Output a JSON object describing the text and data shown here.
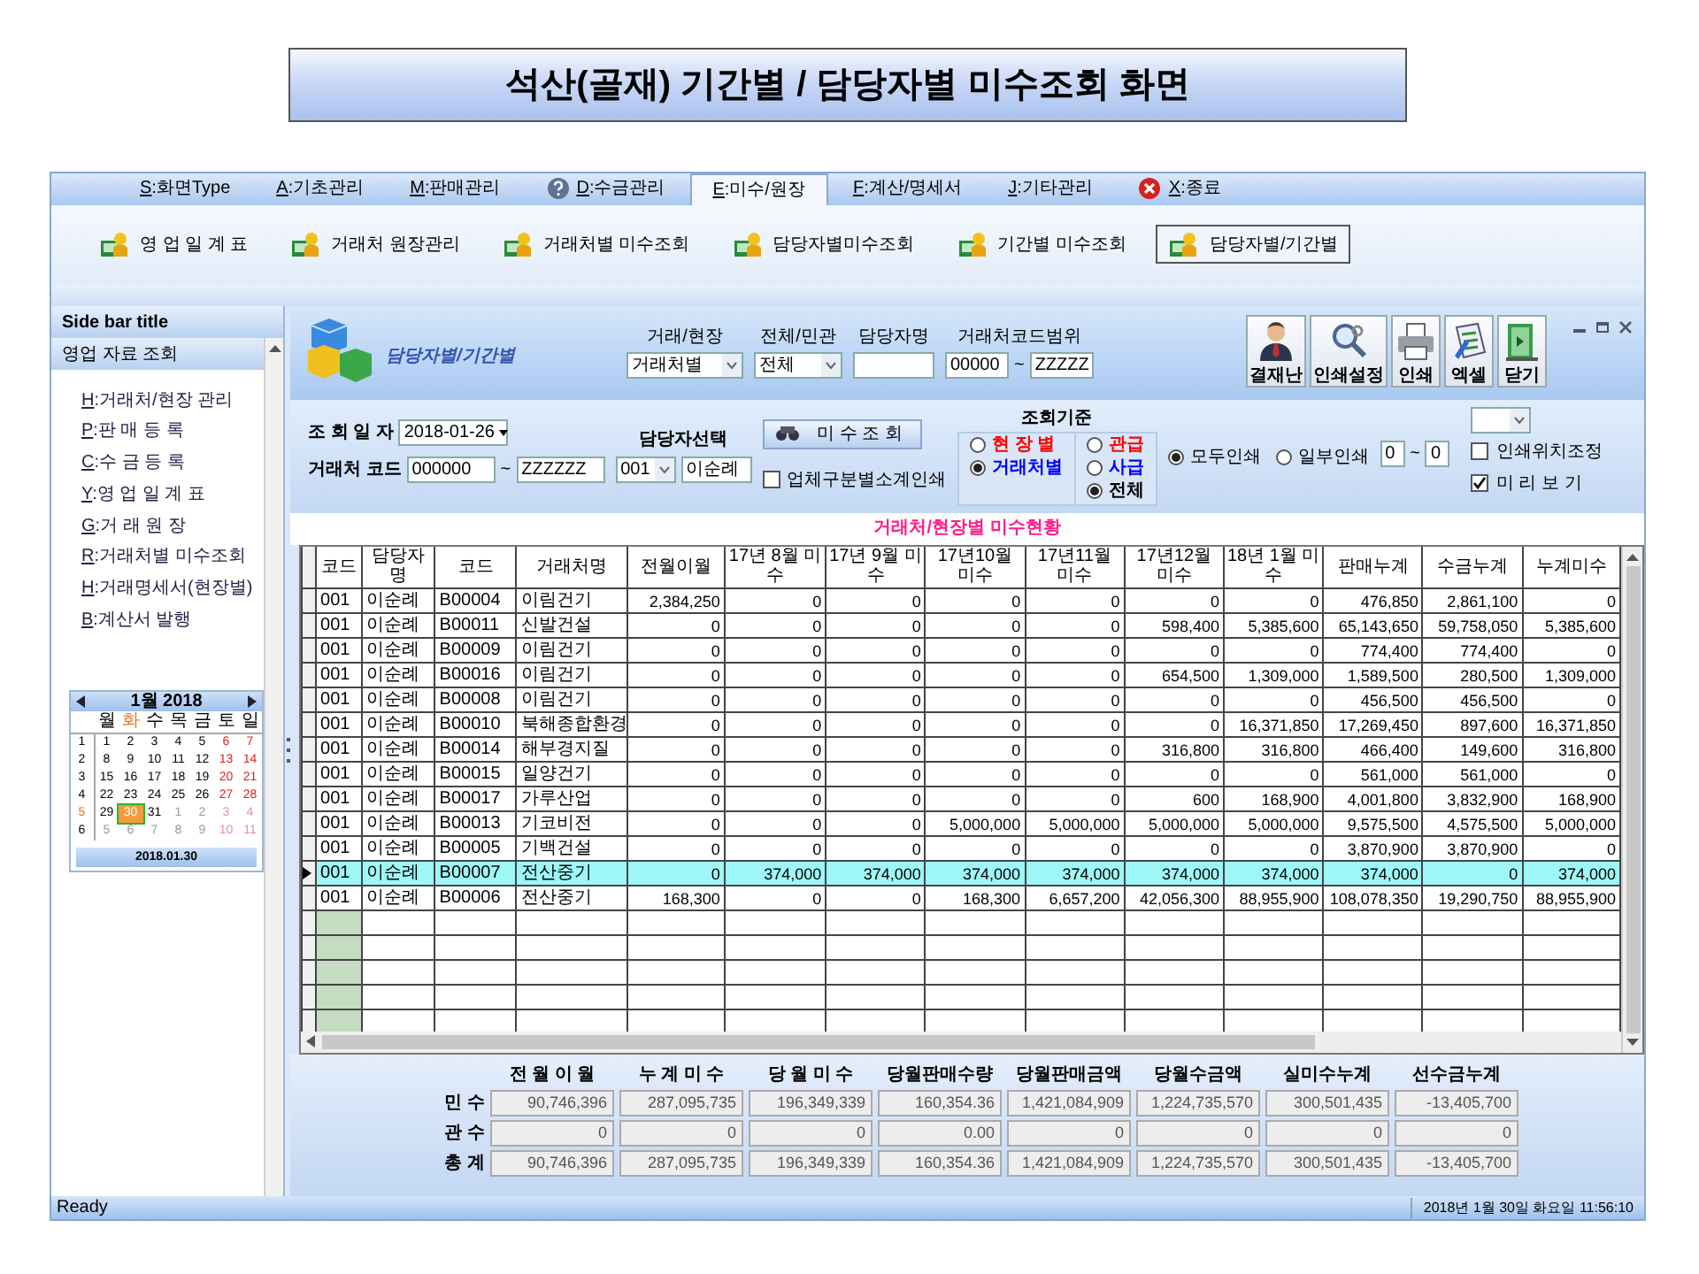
{
  "page_title": "석산(골재) 기간별 / 담당자별 미수조회 화면",
  "menu": [
    {
      "label": "S:화면Type",
      "kind": "plain",
      "selected": false
    },
    {
      "label": "A:기초관리",
      "kind": "plain",
      "selected": false
    },
    {
      "label": "M:판매관리",
      "kind": "plain",
      "selected": false
    },
    {
      "label": "D:수금관리",
      "kind": "help",
      "selected": false
    },
    {
      "label": "E:미수/원장",
      "kind": "plain",
      "selected": true
    },
    {
      "label": "F:계산/명세서",
      "kind": "plain",
      "selected": false
    },
    {
      "label": "J:기타관리",
      "kind": "plain",
      "selected": false
    },
    {
      "label": "X:종료",
      "kind": "exit",
      "selected": false
    }
  ],
  "ribbon": [
    {
      "label": "영 업 일 계 표",
      "selected": false
    },
    {
      "label": "거래처 원장관리",
      "selected": false
    },
    {
      "label": "거래처별 미수조회",
      "selected": false
    },
    {
      "label": "담당자별미수조회",
      "selected": false
    },
    {
      "label": "기간별 미수조회",
      "selected": false
    },
    {
      "label": "담당자별/기간별",
      "selected": true
    }
  ],
  "sidebar": {
    "title": "Side bar title",
    "group": "영업 자료 조회",
    "items": [
      "H:거래처/현장 관리",
      "P:판 매 등 록",
      "C:수 금 등 록",
      "Y:영 업 일 계 표",
      "G:거 래 원 장",
      "R:거래처별 미수조회",
      "H:거래명세서(현장별)",
      "B:계산서 발행"
    ],
    "calendar": {
      "month": "1월 2018",
      "weekdays": [
        {
          "label": "월",
          "current": false
        },
        {
          "label": "화",
          "current": true
        },
        {
          "label": "수",
          "current": false
        },
        {
          "label": "목",
          "current": false
        },
        {
          "label": "금",
          "current": false
        },
        {
          "label": "토",
          "current": false
        },
        {
          "label": "일",
          "current": false
        }
      ],
      "weeks": [
        {
          "number": "1",
          "current": false,
          "days": [
            {
              "day": "1",
              "weekend": false,
              "other": false,
              "selected": false
            },
            {
              "day": "2",
              "weekend": false,
              "other": false,
              "selected": false
            },
            {
              "day": "3",
              "weekend": false,
              "other": false,
              "selected": false
            },
            {
              "day": "4",
              "weekend": false,
              "other": false,
              "selected": false
            },
            {
              "day": "5",
              "weekend": false,
              "other": false,
              "selected": false
            },
            {
              "day": "6",
              "weekend": true,
              "other": false,
              "selected": false
            },
            {
              "day": "7",
              "weekend": true,
              "other": false,
              "selected": false
            }
          ]
        },
        {
          "number": "2",
          "current": false,
          "days": [
            {
              "day": "8",
              "weekend": false,
              "other": false,
              "selected": false
            },
            {
              "day": "9",
              "weekend": false,
              "other": false,
              "selected": false
            },
            {
              "day": "10",
              "weekend": false,
              "other": false,
              "selected": false
            },
            {
              "day": "11",
              "weekend": false,
              "other": false,
              "selected": false
            },
            {
              "day": "12",
              "weekend": false,
              "other": false,
              "selected": false
            },
            {
              "day": "13",
              "weekend": true,
              "other": false,
              "selected": false
            },
            {
              "day": "14",
              "weekend": true,
              "other": false,
              "selected": false
            }
          ]
        },
        {
          "number": "3",
          "current": false,
          "days": [
            {
              "day": "15",
              "weekend": false,
              "other": false,
              "selected": false
            },
            {
              "day": "16",
              "weekend": false,
              "other": false,
              "selected": false
            },
            {
              "day": "17",
              "weekend": false,
              "other": false,
              "selected": false
            },
            {
              "day": "18",
              "weekend": false,
              "other": false,
              "selected": false
            },
            {
              "day": "19",
              "weekend": false,
              "other": false,
              "selected": false
            },
            {
              "day": "20",
              "weekend": true,
              "other": false,
              "selected": false
            },
            {
              "day": "21",
              "weekend": true,
              "other": false,
              "selected": false
            }
          ]
        },
        {
          "number": "4",
          "current": false,
          "days": [
            {
              "day": "22",
              "weekend": false,
              "other": false,
              "selected": false
            },
            {
              "day": "23",
              "weekend": false,
              "other": false,
              "selected": false
            },
            {
              "day": "24",
              "weekend": false,
              "other": false,
              "selected": false
            },
            {
              "day": "25",
              "weekend": false,
              "other": false,
              "selected": false
            },
            {
              "day": "26",
              "weekend": false,
              "other": false,
              "selected": false
            },
            {
              "day": "27",
              "weekend": true,
              "other": false,
              "selected": false
            },
            {
              "day": "28",
              "weekend": true,
              "other": false,
              "selected": false
            }
          ]
        },
        {
          "number": "5",
          "current": true,
          "days": [
            {
              "day": "29",
              "weekend": false,
              "other": false,
              "selected": false
            },
            {
              "day": "30",
              "weekend": false,
              "other": false,
              "selected": true
            },
            {
              "day": "31",
              "weekend": false,
              "other": false,
              "selected": false
            },
            {
              "day": "1",
              "weekend": false,
              "other": true,
              "selected": false
            },
            {
              "day": "2",
              "weekend": false,
              "other": true,
              "selected": false
            },
            {
              "day": "3",
              "weekend": true,
              "other": true,
              "selected": false
            },
            {
              "day": "4",
              "weekend": true,
              "other": true,
              "selected": false
            }
          ]
        },
        {
          "number": "6",
          "current": false,
          "days": [
            {
              "day": "5",
              "weekend": false,
              "other": true,
              "selected": false
            },
            {
              "day": "6",
              "weekend": false,
              "other": true,
              "selected": false
            },
            {
              "day": "7",
              "weekend": false,
              "other": true,
              "selected": false
            },
            {
              "day": "8",
              "weekend": false,
              "other": true,
              "selected": false
            },
            {
              "day": "9",
              "weekend": false,
              "other": true,
              "selected": false
            },
            {
              "day": "10",
              "weekend": true,
              "other": true,
              "selected": false
            },
            {
              "day": "11",
              "weekend": true,
              "other": true,
              "selected": false
            }
          ]
        }
      ],
      "footer": "2018.01.30"
    }
  },
  "form": {
    "title": "담당자별/기간별",
    "filters": [
      {
        "label": "거래/현장",
        "kind": "combo",
        "value": "거래처별"
      },
      {
        "label": "전체/민관",
        "kind": "combo",
        "value": "전체"
      },
      {
        "label": "담당자명",
        "kind": "text"
      },
      {
        "label": "거래처코드범위",
        "kind": "range",
        "from": "00000",
        "separator": "~",
        "to": "ZZZZZ"
      }
    ],
    "actions": [
      {
        "label": "결재난",
        "kind": "person"
      },
      {
        "label": "인쇄설정",
        "kind": "magnifier"
      },
      {
        "label": "인쇄",
        "kind": "printer"
      },
      {
        "label": "엑셀",
        "kind": "sheet"
      },
      {
        "label": "닫기",
        "kind": "exit"
      }
    ]
  },
  "query": {
    "date_label": "조 회 일 자",
    "date": "2018-01-26",
    "code_label": "거래처 코드",
    "code_from": "000000",
    "code_separator": "~",
    "code_to": "ZZZZZZ",
    "manager_label": "담당자선택",
    "manager_code": "001",
    "manager_name": "이순례",
    "search_button": "미 수 조 회",
    "subtotal": {
      "label": "업체구분별소계인쇄",
      "checked": false
    },
    "criteria": {
      "title": "조회기준",
      "groups": [
        {
          "options": [
            {
              "label": "현 장 별",
              "color": "#ff0000",
              "selected": false
            },
            {
              "label": "거래처별",
              "color": "#0000ff",
              "selected": true
            }
          ]
        },
        {
          "options": [
            {
              "label": "관급",
              "color": "#ff0000",
              "selected": false
            },
            {
              "label": "사급",
              "color": "#0000ff",
              "selected": false
            },
            {
              "label": "전체",
              "color": "#000000",
              "selected": true
            }
          ]
        }
      ]
    },
    "print_mode": [
      {
        "label": "모두인쇄",
        "selected": true
      },
      {
        "label": "일부인쇄",
        "selected": false
      }
    ],
    "pages_from": "0",
    "pages_separator": "~",
    "pages_to": "0",
    "options": [
      {
        "label": "인쇄위치조정",
        "checked": false
      },
      {
        "label": "미 리 보 기",
        "checked": true
      }
    ]
  },
  "table": {
    "title": "거래처/현장별 미수현황",
    "columns": [
      "코드",
      "담당자명",
      "코드",
      "거래처명",
      "전월이월",
      "17년 8월 미수",
      "17년 9월 미수",
      "17년10월 미수",
      "17년11월 미수",
      "17년12월 미수",
      "18년 1월 미수",
      "판매누계",
      "수금누계",
      "누계미수"
    ],
    "rows": [
      {
        "selected": false,
        "cells": [
          "001",
          "이순례",
          "B00004",
          "이림건기",
          "2,384,250",
          "0",
          "0",
          "0",
          "0",
          "0",
          "0",
          "476,850",
          "2,861,100",
          "0"
        ]
      },
      {
        "selected": false,
        "cells": [
          "001",
          "이순례",
          "B00011",
          "신발건설",
          "0",
          "0",
          "0",
          "0",
          "0",
          "598,400",
          "5,385,600",
          "65,143,650",
          "59,758,050",
          "5,385,600"
        ]
      },
      {
        "selected": false,
        "cells": [
          "001",
          "이순례",
          "B00009",
          "이림건기",
          "0",
          "0",
          "0",
          "0",
          "0",
          "0",
          "0",
          "774,400",
          "774,400",
          "0"
        ]
      },
      {
        "selected": false,
        "cells": [
          "001",
          "이순례",
          "B00016",
          "이림건기",
          "0",
          "0",
          "0",
          "0",
          "0",
          "654,500",
          "1,309,000",
          "1,589,500",
          "280,500",
          "1,309,000"
        ]
      },
      {
        "selected": false,
        "cells": [
          "001",
          "이순례",
          "B00008",
          "이림건기",
          "0",
          "0",
          "0",
          "0",
          "0",
          "0",
          "0",
          "456,500",
          "456,500",
          "0"
        ]
      },
      {
        "selected": false,
        "cells": [
          "001",
          "이순례",
          "B00010",
          "북해종합환경",
          "0",
          "0",
          "0",
          "0",
          "0",
          "0",
          "16,371,850",
          "17,269,450",
          "897,600",
          "16,371,850"
        ]
      },
      {
        "selected": false,
        "cells": [
          "001",
          "이순례",
          "B00014",
          "해부경지질",
          "0",
          "0",
          "0",
          "0",
          "0",
          "316,800",
          "316,800",
          "466,400",
          "149,600",
          "316,800"
        ]
      },
      {
        "selected": false,
        "cells": [
          "001",
          "이순례",
          "B00015",
          "일양건기",
          "0",
          "0",
          "0",
          "0",
          "0",
          "0",
          "0",
          "561,000",
          "561,000",
          "0"
        ]
      },
      {
        "selected": false,
        "cells": [
          "001",
          "이순례",
          "B00017",
          "가루산업",
          "0",
          "0",
          "0",
          "0",
          "0",
          "600",
          "168,900",
          "4,001,800",
          "3,832,900",
          "168,900"
        ]
      },
      {
        "selected": false,
        "cells": [
          "001",
          "이순례",
          "B00013",
          "기코비전",
          "0",
          "0",
          "0",
          "5,000,000",
          "5,000,000",
          "5,000,000",
          "5,000,000",
          "9,575,500",
          "4,575,500",
          "5,000,000"
        ]
      },
      {
        "selected": false,
        "cells": [
          "001",
          "이순례",
          "B00005",
          "기백건설",
          "0",
          "0",
          "0",
          "0",
          "0",
          "0",
          "0",
          "3,870,900",
          "3,870,900",
          "0"
        ]
      },
      {
        "selected": true,
        "cells": [
          "001",
          "이순례",
          "B00007",
          "전산중기",
          "0",
          "374,000",
          "374,000",
          "374,000",
          "374,000",
          "374,000",
          "374,000",
          "374,000",
          "0",
          "374,000"
        ]
      },
      {
        "selected": false,
        "cells": [
          "001",
          "이순례",
          "B00006",
          "전산중기",
          "168,300",
          "0",
          "0",
          "168,300",
          "6,657,200",
          "42,056,300",
          "88,955,900",
          "108,078,350",
          "19,290,750",
          "88,955,900"
        ]
      }
    ]
  },
  "summary": {
    "columns": [
      "전 월 이 월",
      "누 계 미 수",
      "당 월 미 수",
      "당월판매수량",
      "당월판매금액",
      "당월수금액",
      "실미수누계",
      "선수금누계"
    ],
    "rows": [
      {
        "label": "민 수",
        "values": [
          "90,746,396",
          "287,095,735",
          "196,349,339",
          "160,354.36",
          "1,421,084,909",
          "1,224,735,570",
          "300,501,435",
          "-13,405,700"
        ]
      },
      {
        "label": "관 수",
        "values": [
          "0",
          "0",
          "0",
          "0.00",
          "0",
          "0",
          "0",
          "0"
        ]
      },
      {
        "label": "총 계",
        "values": [
          "90,746,396",
          "287,095,735",
          "196,349,339",
          "160,354.36",
          "1,421,084,909",
          "1,224,735,570",
          "300,501,435",
          "-13,405,700"
        ]
      }
    ]
  },
  "status_bar": {
    "left": "Ready",
    "right": "2018년 1월 30일 화요일 11:56:10"
  }
}
